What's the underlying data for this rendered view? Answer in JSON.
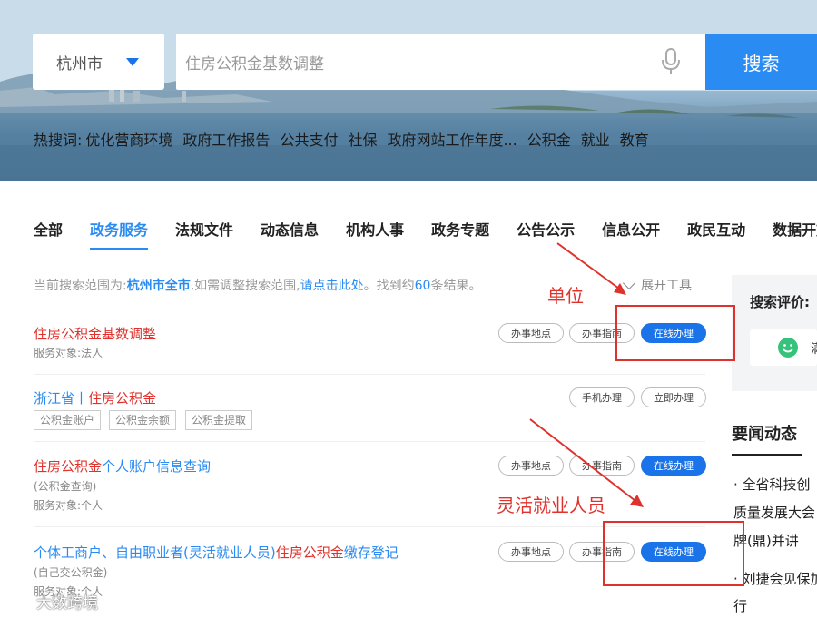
{
  "search": {
    "city": "杭州市",
    "query": "住房公积金基数调整",
    "button": "搜索"
  },
  "hotwords": {
    "label": "热搜词:",
    "items": [
      "优化营商环境",
      "政府工作报告",
      "公共支付",
      "社保",
      "政府网站工作年度...",
      "公积金",
      "就业",
      "教育"
    ]
  },
  "tabs": [
    "全部",
    "政务服务",
    "法规文件",
    "动态信息",
    "机构人事",
    "政务专题",
    "公告公示",
    "信息公开",
    "政民互动",
    "数据开放"
  ],
  "active_tab": "政务服务",
  "scope": {
    "prefix": "当前搜索范围为:",
    "city": "杭州市全市",
    "middle": ",如需调整搜索范围,",
    "link": "请点击此处",
    "found_prefix": "。找到约",
    "count": "60",
    "found_suffix": "条结果。",
    "expand": "展开工具"
  },
  "results": [
    {
      "title_parts": [
        {
          "text": "住房公积金基数调整",
          "hl": true
        }
      ],
      "sub": "服务对象:法人",
      "buttons": [
        "办事地点",
        "办事指南",
        "在线办理"
      ]
    },
    {
      "title_parts": [
        {
          "text": "浙江省丨",
          "hl": false
        },
        {
          "text": "住房公积金",
          "hl": true
        }
      ],
      "tags": [
        "公积金账户",
        "公积金余额",
        "公积金提取"
      ],
      "buttons": [
        "手机办理",
        "立即办理"
      ]
    },
    {
      "title_parts": [
        {
          "text": "住房公积金",
          "hl": true
        },
        {
          "text": "个人账户信息查询",
          "hl": false
        }
      ],
      "alias": "(公积金查询)",
      "sub": "服务对象:个人",
      "buttons": [
        "办事地点",
        "办事指南",
        "在线办理"
      ]
    },
    {
      "title_parts": [
        {
          "text": "个体工商户、自由职业者(灵活就业人员)",
          "hl": false
        },
        {
          "text": "住房公积金",
          "hl": true
        },
        {
          "text": "缴存登记",
          "hl": false
        }
      ],
      "alias": "(自己交公积金)",
      "sub": "服务对象:个人",
      "buttons": [
        "办事地点",
        "办事指南",
        "在线办理"
      ]
    }
  ],
  "sidebar": {
    "eval_title": "搜索评价:",
    "eval_option": "满",
    "news_title": "要闻动态",
    "news_lines": [
      "· 全省科技创",
      "质量发展大会",
      "牌(鼎)并讲",
      "· 刘捷会见保加",
      "行"
    ]
  },
  "annotations": {
    "label_unit": "单位",
    "label_flexible": "灵活就业人员"
  },
  "watermark": "大数跨境",
  "colors": {
    "primary": "#2a8bf2",
    "highlight": "#e0322d",
    "annotation": "#e0322d"
  }
}
